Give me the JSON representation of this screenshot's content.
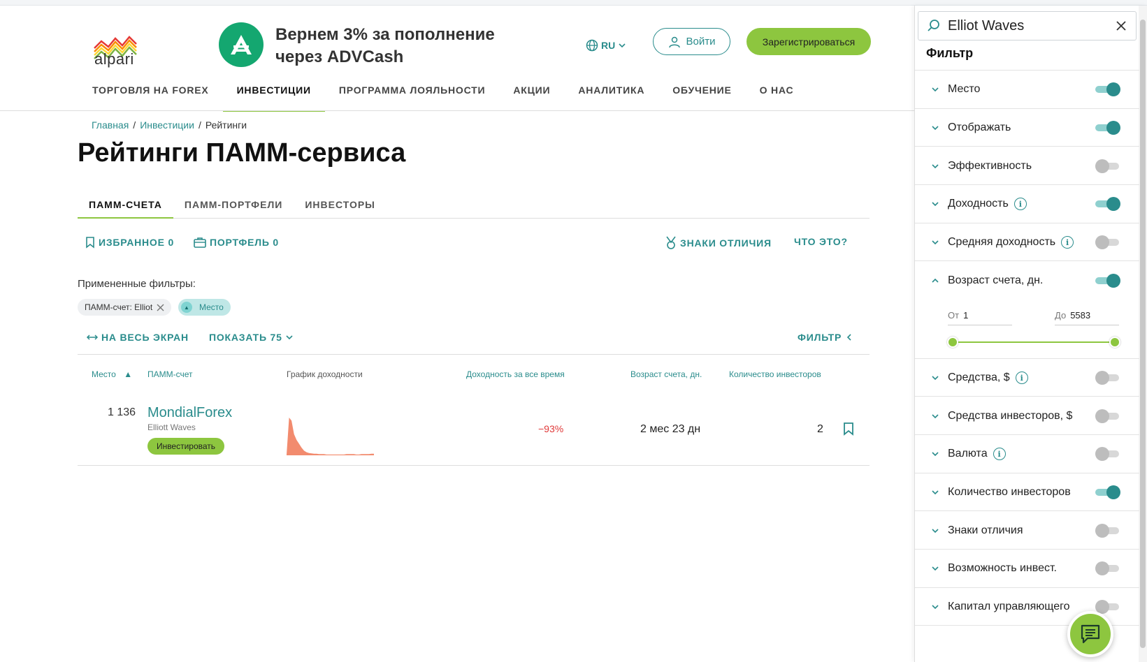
{
  "brand": {
    "logo_text": "alpari"
  },
  "promo": {
    "text": "Вернем 3% за пополнение через ADVCash"
  },
  "header": {
    "lang": "RU",
    "login": "Войти",
    "register": "Зарегистрироваться"
  },
  "nav": {
    "items": [
      "ТОРГОВЛЯ НА FOREX",
      "ИНВЕСТИЦИИ",
      "ПРОГРАММА ЛОЯЛЬНОСТИ",
      "АКЦИИ",
      "АНАЛИТИКА",
      "ОБУЧЕНИЕ",
      "О НАС"
    ],
    "active": "ИНВЕСТИЦИИ"
  },
  "breadcrumb": {
    "home": "Главная",
    "section": "Инвестиции",
    "current": "Рейтинги",
    "sep": "/"
  },
  "page": {
    "title": "Рейтинги ПАММ-сервиса"
  },
  "tabs": [
    "ПАММ-СЧЕТА",
    "ПАММ-ПОРТФЕЛИ",
    "ИНВЕСТОРЫ"
  ],
  "actions": {
    "favorites": "ИЗБРАННОЕ 0",
    "portfolio": "ПОРТФЕЛЬ 0",
    "badges": "ЗНАКИ ОТЛИЧИЯ",
    "what": "ЧТО ЭТО?"
  },
  "applied": {
    "label": "Примененные фильтры:",
    "chip1": "ПАММ-счет: Elliot",
    "chip2": "Место"
  },
  "controls": {
    "fullscreen": "НА ВЕСЬ ЭКРАН",
    "show": "ПОКАЗАТЬ 75",
    "filter": "ФИЛЬТР"
  },
  "table": {
    "headers": {
      "place": "Место",
      "account": "ПАММ-счет",
      "chart": "График доходности",
      "yield": "Доходность за все время",
      "age": "Возраст счета, дн.",
      "investors": "Количество инвесторов"
    },
    "rows": [
      {
        "rank": "1 136",
        "name": "MondialForex",
        "sub": "Elliott Waves",
        "invest": "Инвестировать",
        "yield": "−93%",
        "age": "2 мес 23 дн",
        "investors": "2",
        "spark": [
          2,
          98,
          90,
          55,
          40,
          30,
          20,
          12,
          8,
          6,
          5,
          4,
          4,
          3,
          3,
          3,
          2,
          2,
          2,
          2,
          2,
          2,
          2,
          2,
          3,
          3,
          3,
          3,
          2,
          2,
          3,
          3,
          3,
          3,
          4,
          4
        ]
      }
    ]
  },
  "panel": {
    "search_value": "Elliot Waves",
    "title": "Фильтр",
    "filters": [
      {
        "label": "Место",
        "on": true,
        "info": false,
        "open": false
      },
      {
        "label": "Отображать",
        "on": true,
        "info": false,
        "open": false
      },
      {
        "label": "Эффективность",
        "on": false,
        "info": false,
        "open": false
      },
      {
        "label": "Доходность",
        "on": true,
        "info": true,
        "open": false
      },
      {
        "label": "Средняя доходность",
        "on": false,
        "info": true,
        "open": false
      },
      {
        "label": "Возраст счета, дн.",
        "on": true,
        "info": false,
        "open": true
      },
      {
        "label": "Средства, $",
        "on": false,
        "info": true,
        "open": false
      },
      {
        "label": "Средства инвесторов, $",
        "on": false,
        "info": false,
        "open": false
      },
      {
        "label": "Валюта",
        "on": false,
        "info": true,
        "open": false
      },
      {
        "label": "Количество инвесторов",
        "on": true,
        "info": false,
        "open": false
      },
      {
        "label": "Знаки отличия",
        "on": false,
        "info": false,
        "open": false
      },
      {
        "label": "Возможность инвест.",
        "on": false,
        "info": false,
        "open": false
      },
      {
        "label": "Капитал управляющего",
        "on": false,
        "info": false,
        "open": false
      }
    ],
    "range": {
      "from_label": "От",
      "from_value": "1",
      "to_label": "До",
      "to_value": "5583"
    }
  },
  "colors": {
    "accent": "#2a8c8c",
    "green": "#8dc63f",
    "negative": "#e03a3a",
    "spark": "#f28b6e"
  }
}
